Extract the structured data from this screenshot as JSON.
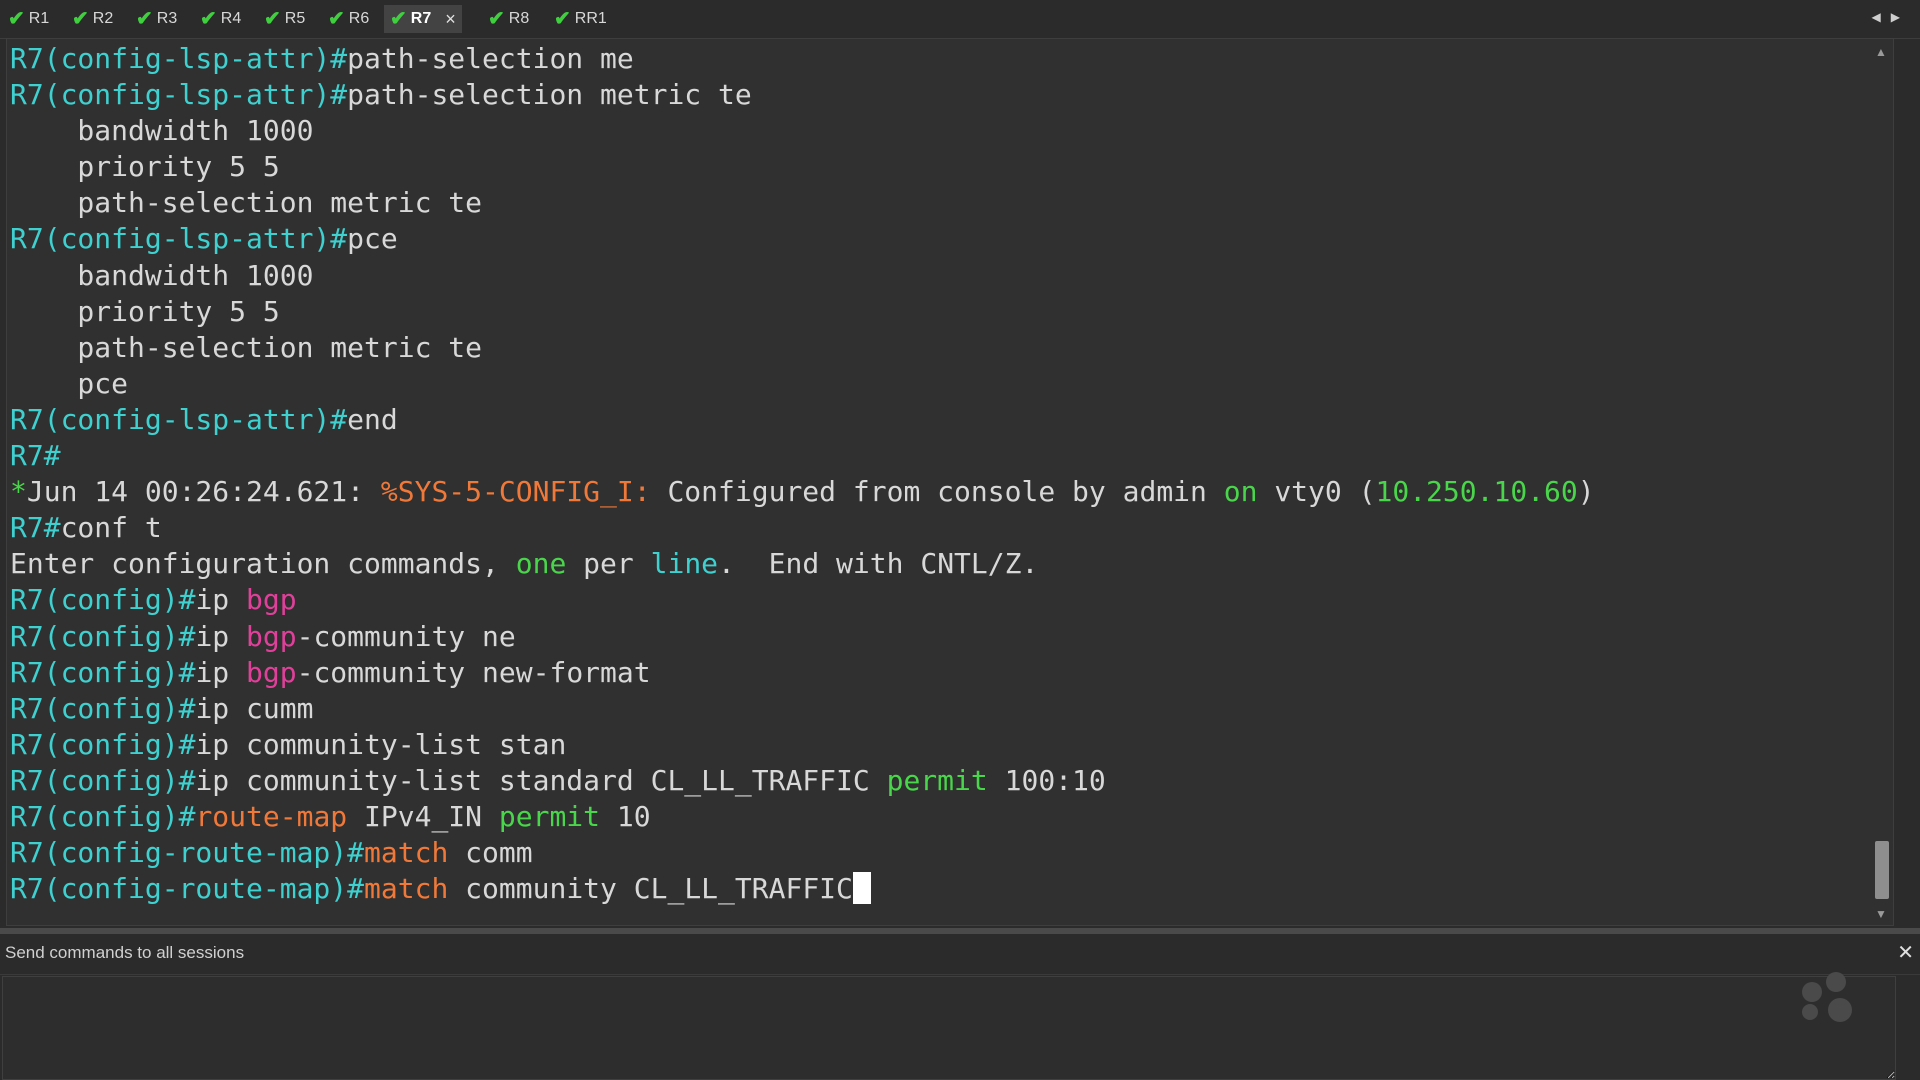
{
  "tabs": [
    {
      "label": "R1",
      "active": false
    },
    {
      "label": "R2",
      "active": false
    },
    {
      "label": "R3",
      "active": false
    },
    {
      "label": "R4",
      "active": false
    },
    {
      "label": "R5",
      "active": false
    },
    {
      "label": "R6",
      "active": false
    },
    {
      "label": "R7",
      "active": true
    },
    {
      "label": "R8",
      "active": false
    },
    {
      "label": "RR1",
      "active": false
    }
  ],
  "tab_close": "×",
  "tab_check": "✔",
  "scroll_left": "◀",
  "scroll_right": "▶",
  "colors": {
    "prompt": "#3fd0d0",
    "keyword_orange": "#f0793a",
    "keyword_green": "#49d64a",
    "keyword_magenta": "#e0409a",
    "text": "#d8d8d8",
    "check": "#3fcf3f"
  },
  "terminal": {
    "lines": [
      [
        {
          "t": "R7(config-lsp-attr)#",
          "c": "cyan"
        },
        {
          "t": "path-selection me",
          "c": "white"
        }
      ],
      [
        {
          "t": "R7(config-lsp-attr)#",
          "c": "cyan"
        },
        {
          "t": "path-selection metric te",
          "c": "white"
        }
      ],
      [
        {
          "t": "    bandwidth 1000",
          "c": "white"
        }
      ],
      [
        {
          "t": "    priority 5 5",
          "c": "white"
        }
      ],
      [
        {
          "t": "    path-selection metric te",
          "c": "white"
        }
      ],
      [
        {
          "t": "R7(config-lsp-attr)#",
          "c": "cyan"
        },
        {
          "t": "pce",
          "c": "white"
        }
      ],
      [
        {
          "t": "    bandwidth 1000",
          "c": "white"
        }
      ],
      [
        {
          "t": "    priority 5 5",
          "c": "white"
        }
      ],
      [
        {
          "t": "    path-selection metric te",
          "c": "white"
        }
      ],
      [
        {
          "t": "    pce",
          "c": "white"
        }
      ],
      [
        {
          "t": "R7(config-lsp-attr)#",
          "c": "cyan"
        },
        {
          "t": "end",
          "c": "white"
        }
      ],
      [
        {
          "t": "R7#",
          "c": "cyan"
        }
      ],
      [
        {
          "t": "*",
          "c": "green"
        },
        {
          "t": "Jun 14 00:26:24.621: ",
          "c": "white"
        },
        {
          "t": "%SYS-5-CONFIG_I:",
          "c": "orange"
        },
        {
          "t": " Configured from console by admin ",
          "c": "white"
        },
        {
          "t": "on",
          "c": "green"
        },
        {
          "t": " vty0 (",
          "c": "white"
        },
        {
          "t": "10.250.10.60",
          "c": "green"
        },
        {
          "t": ")",
          "c": "white"
        }
      ],
      [
        {
          "t": "R7#",
          "c": "cyan"
        },
        {
          "t": "conf t",
          "c": "white"
        }
      ],
      [
        {
          "t": "Enter configuration commands, ",
          "c": "white"
        },
        {
          "t": "one",
          "c": "green"
        },
        {
          "t": " per ",
          "c": "white"
        },
        {
          "t": "line",
          "c": "cyan"
        },
        {
          "t": ".  End with CNTL/Z.",
          "c": "white"
        }
      ],
      [
        {
          "t": "R7(config)#",
          "c": "cyan"
        },
        {
          "t": "ip ",
          "c": "white"
        },
        {
          "t": "bgp",
          "c": "magenta"
        }
      ],
      [
        {
          "t": "R7(config)#",
          "c": "cyan"
        },
        {
          "t": "ip ",
          "c": "white"
        },
        {
          "t": "bgp",
          "c": "magenta"
        },
        {
          "t": "-community ne",
          "c": "white"
        }
      ],
      [
        {
          "t": "R7(config)#",
          "c": "cyan"
        },
        {
          "t": "ip ",
          "c": "white"
        },
        {
          "t": "bgp",
          "c": "magenta"
        },
        {
          "t": "-community new-format",
          "c": "white"
        }
      ],
      [
        {
          "t": "R7(config)#",
          "c": "cyan"
        },
        {
          "t": "ip cumm",
          "c": "white"
        }
      ],
      [
        {
          "t": "R7(config)#",
          "c": "cyan"
        },
        {
          "t": "ip community-list stan",
          "c": "white"
        }
      ],
      [
        {
          "t": "R7(config)#",
          "c": "cyan"
        },
        {
          "t": "ip community-list standard CL_LL_TRAFFIC ",
          "c": "white"
        },
        {
          "t": "permit",
          "c": "green"
        },
        {
          "t": " 100:10",
          "c": "white"
        }
      ],
      [
        {
          "t": "R7(config)#",
          "c": "cyan"
        },
        {
          "t": "route-map",
          "c": "orange"
        },
        {
          "t": " IPv4_IN ",
          "c": "white"
        },
        {
          "t": "permit",
          "c": "green"
        },
        {
          "t": " 10",
          "c": "white"
        }
      ],
      [
        {
          "t": "R7(config-route-map)#",
          "c": "cyan"
        },
        {
          "t": "match",
          "c": "orange"
        },
        {
          "t": " comm",
          "c": "white"
        }
      ],
      [
        {
          "t": "R7(config-route-map)#",
          "c": "cyan"
        },
        {
          "t": "match",
          "c": "orange"
        },
        {
          "t": " community CL_LL_TRAFFIC",
          "c": "white"
        }
      ]
    ],
    "scroll_up": "▲",
    "scroll_down": "▼"
  },
  "send_panel": {
    "label": "Send commands to all sessions",
    "close": "✕",
    "input_value": ""
  }
}
